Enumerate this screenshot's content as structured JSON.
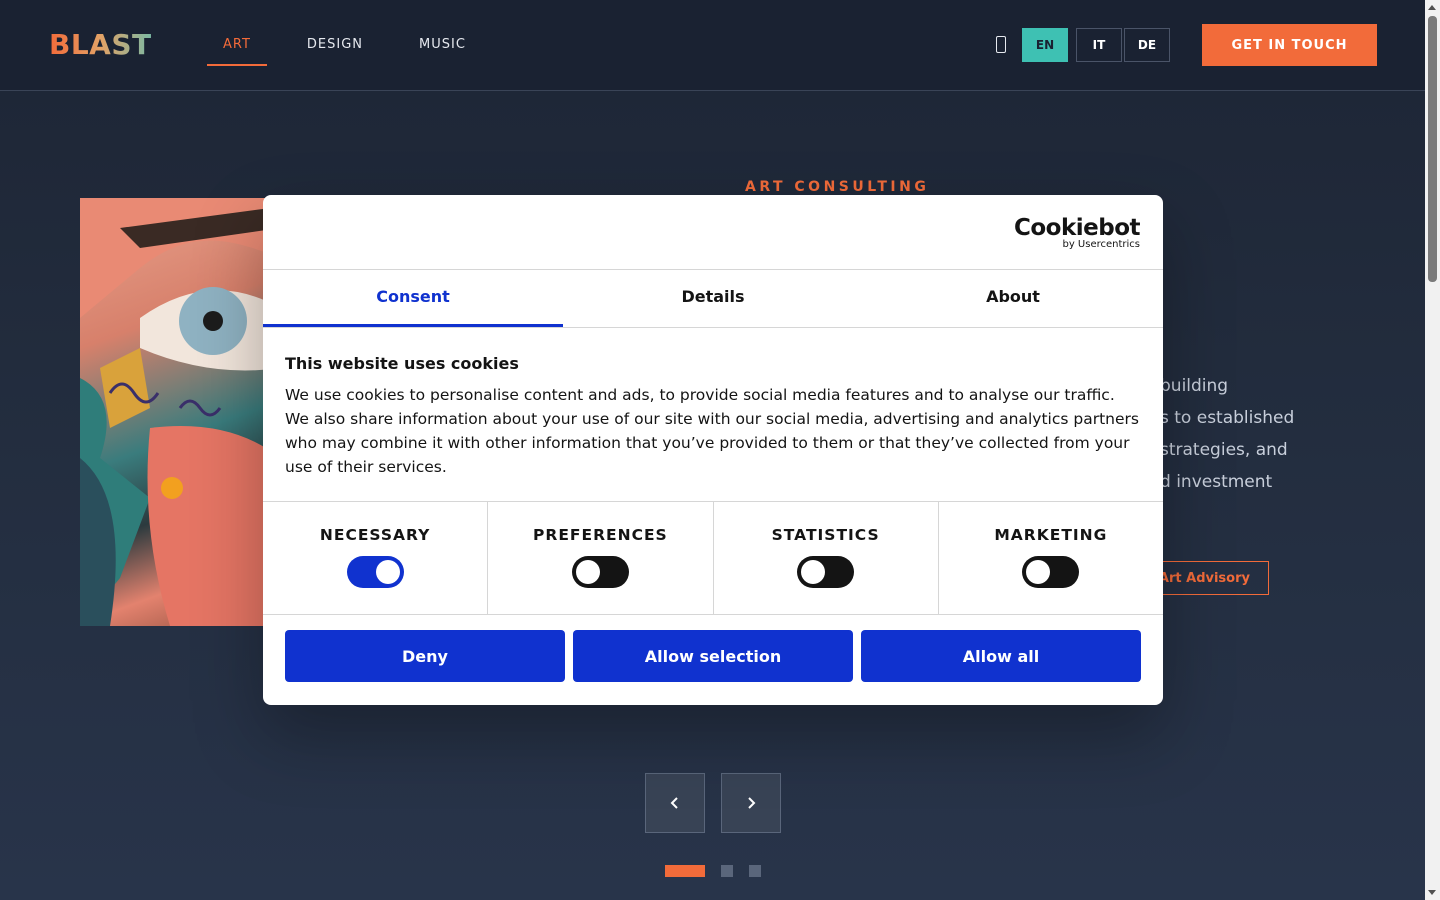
{
  "header": {
    "logo": "BLAST",
    "nav": [
      {
        "label": "ART",
        "active": true
      },
      {
        "label": "DESIGN",
        "active": false
      },
      {
        "label": "MUSIC",
        "active": false
      }
    ],
    "languages": [
      {
        "code": "EN",
        "active": true
      },
      {
        "code": "IT",
        "active": false
      },
      {
        "code": "DE",
        "active": false
      }
    ],
    "cta": "GET IN TOUCH"
  },
  "hero": {
    "eyebrow": "ART CONSULTING",
    "text_lines": [
      "building",
      "s to established",
      "strategies, and",
      "d investment"
    ],
    "advisory_button": "Art Advisory",
    "prev_icon": "chevron-left-icon",
    "next_icon": "chevron-right-icon",
    "slides": {
      "current": 1,
      "total": 3
    }
  },
  "cookie_dialog": {
    "brand": "Cookiebot",
    "brand_sub": "by Usercentrics",
    "tabs": [
      {
        "label": "Consent",
        "active": true
      },
      {
        "label": "Details",
        "active": false
      },
      {
        "label": "About",
        "active": false
      }
    ],
    "title": "This website uses cookies",
    "description": "We use cookies to personalise content and ads, to provide social media features and to analyse our traffic. We also share information about your use of our site with our social media, advertising and analytics partners who may combine it with other information that you’ve provided to them or that they’ve collected from your use of their services.",
    "toggles": [
      {
        "label": "NECESSARY",
        "on": true
      },
      {
        "label": "PREFERENCES",
        "on": false
      },
      {
        "label": "STATISTICS",
        "on": false
      },
      {
        "label": "MARKETING",
        "on": false
      }
    ],
    "buttons": {
      "deny": "Deny",
      "allow_selection": "Allow selection",
      "allow_all": "Allow all"
    }
  },
  "colors": {
    "accent": "#f26b3a",
    "teal": "#3ec1b3",
    "cookie_blue": "#1032cf"
  }
}
